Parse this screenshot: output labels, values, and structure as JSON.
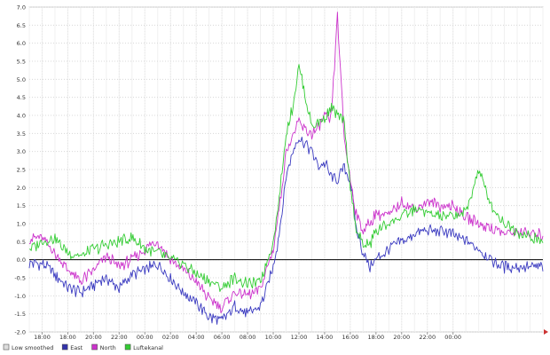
{
  "chart_data": {
    "type": "line",
    "title": "",
    "xlabel": "",
    "ylabel": "",
    "grid": true,
    "legend_position": "bottom-left",
    "ylim": [
      -2.0,
      7.0
    ],
    "y_ticks": [
      "7.0",
      "6.5",
      "6.0",
      "5.5",
      "5.0",
      "4.5",
      "4.0",
      "3.5",
      "3.0",
      "2.5",
      "2.0",
      "1.5",
      "1.0",
      "0.5",
      "0.0",
      "-0.5",
      "-1.0",
      "-1.5",
      "-2.0"
    ],
    "x_range_hours": [
      0,
      40
    ],
    "x_ticks": [
      {
        "label": "18:00",
        "hour": 1
      },
      {
        "label": "18:00",
        "hour": 3
      },
      {
        "label": "20:00",
        "hour": 5
      },
      {
        "label": "22:00",
        "hour": 7
      },
      {
        "label": "00:00",
        "hour": 9
      },
      {
        "label": "02:00",
        "hour": 11
      },
      {
        "label": "04:00",
        "hour": 13
      },
      {
        "label": "06:00",
        "hour": 15
      },
      {
        "label": "08:00",
        "hour": 17
      },
      {
        "label": "10:00",
        "hour": 19
      },
      {
        "label": "12:00",
        "hour": 21
      },
      {
        "label": "14:00",
        "hour": 23
      },
      {
        "label": "16:00",
        "hour": 25
      },
      {
        "label": "18:00",
        "hour": 27
      },
      {
        "label": "20:00",
        "hour": 29
      },
      {
        "label": "22:00",
        "hour": 31
      },
      {
        "label": "00:00",
        "hour": 33
      }
    ],
    "legend": [
      {
        "name": "Low smoothed",
        "color": "#dddddd"
      },
      {
        "name": "East",
        "color": "#3333aa"
      },
      {
        "name": "North",
        "color": "#cc33cc"
      },
      {
        "name": "Luftekanal",
        "color": "#33cc33"
      }
    ],
    "series": [
      {
        "name": "East",
        "color": "#3a3ac0",
        "x": [
          0,
          1,
          2,
          3,
          4,
          5,
          6,
          7,
          8,
          9,
          10,
          11,
          12,
          13,
          14,
          15,
          16,
          17,
          18,
          19,
          19.5,
          20,
          20.5,
          21,
          21.5,
          22,
          22.5,
          23,
          23.5,
          24,
          24.5,
          25,
          25.5,
          26,
          26.5,
          27,
          28,
          29,
          30,
          31,
          32,
          33,
          34,
          35,
          36,
          37,
          38,
          39,
          40
        ],
        "y": [
          -0.1,
          -0.1,
          -0.4,
          -0.8,
          -0.9,
          -0.7,
          -0.5,
          -0.8,
          -0.4,
          -0.3,
          -0.1,
          -0.5,
          -0.9,
          -1.2,
          -1.6,
          -1.7,
          -1.3,
          -1.5,
          -1.3,
          -0.2,
          0.8,
          2.3,
          3.0,
          3.4,
          3.2,
          3.0,
          2.6,
          2.7,
          2.3,
          2.2,
          2.6,
          2.2,
          0.8,
          0.2,
          -0.2,
          0.0,
          0.3,
          0.5,
          0.7,
          0.8,
          0.8,
          0.7,
          0.5,
          0.3,
          0.0,
          -0.2,
          -0.2,
          -0.2,
          -0.2
        ]
      },
      {
        "name": "North",
        "color": "#cc33cc",
        "x": [
          0,
          1,
          2,
          3,
          4,
          5,
          6,
          7,
          8,
          9,
          10,
          11,
          12,
          13,
          14,
          15,
          16,
          17,
          18,
          19,
          19.5,
          20,
          20.5,
          21,
          21.5,
          22,
          22.5,
          23,
          23.5,
          24,
          24.5,
          25,
          25.5,
          26,
          26.5,
          27,
          28,
          29,
          30,
          31,
          32,
          33,
          34,
          35,
          36,
          37,
          38,
          39,
          40
        ],
        "y": [
          0.6,
          0.6,
          0.2,
          -0.3,
          -0.6,
          -0.3,
          0.1,
          -0.2,
          0.0,
          0.3,
          0.5,
          0.0,
          -0.3,
          -0.6,
          -1.1,
          -1.3,
          -0.9,
          -1.0,
          -0.8,
          0.3,
          1.5,
          3.0,
          3.4,
          3.8,
          3.6,
          3.5,
          3.6,
          4.0,
          3.8,
          6.8,
          3.5,
          2.2,
          1.2,
          0.8,
          1.0,
          1.3,
          1.2,
          1.6,
          1.4,
          1.6,
          1.5,
          1.5,
          1.2,
          1.0,
          0.9,
          0.7,
          0.8,
          0.7,
          0.7
        ]
      },
      {
        "name": "Luftekanal",
        "color": "#33cc33",
        "x": [
          0,
          1,
          2,
          3,
          4,
          5,
          6,
          7,
          8,
          9,
          10,
          11,
          12,
          13,
          14,
          15,
          16,
          17,
          18,
          19,
          19.5,
          20,
          20.5,
          21,
          21.5,
          22,
          22.5,
          23,
          23.5,
          24,
          24.5,
          25,
          25.5,
          26,
          26.5,
          27,
          28,
          29,
          30,
          31,
          32,
          33,
          34,
          35,
          36,
          37,
          38,
          39,
          40
        ],
        "y": [
          0.3,
          0.5,
          0.6,
          0.2,
          0.1,
          0.3,
          0.4,
          0.5,
          0.6,
          0.3,
          0.2,
          0.0,
          -0.1,
          -0.4,
          -0.6,
          -0.8,
          -0.5,
          -0.7,
          -0.6,
          0.5,
          1.8,
          3.5,
          4.2,
          5.4,
          4.5,
          3.7,
          3.8,
          3.9,
          4.2,
          4.0,
          3.8,
          2.0,
          0.8,
          0.4,
          0.4,
          0.8,
          1.0,
          1.2,
          1.4,
          1.3,
          1.2,
          1.2,
          1.3,
          2.5,
          1.5,
          1.0,
          0.8,
          0.6,
          0.5
        ]
      }
    ]
  }
}
